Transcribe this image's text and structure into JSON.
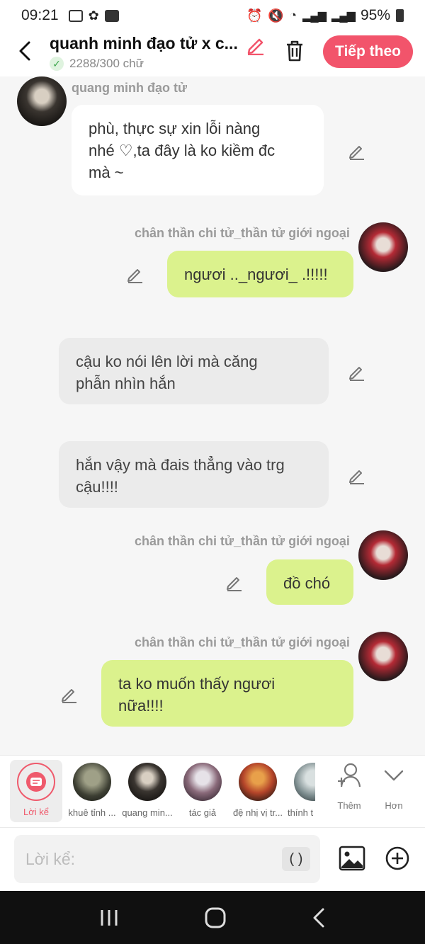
{
  "status_bar": {
    "time": "09:21",
    "battery": "95%"
  },
  "header": {
    "title": "quanh minh đạo tử x c...",
    "word_count": "2288/300 chữ",
    "next_label": "Tiếp theo"
  },
  "messages": [
    {
      "sender": "quang minh đạo tử",
      "text_lines": [
        "phù, thực sự xin lỗi nàng",
        "nhé ♡,ta đây  là ko kiềm đc",
        "mà ~"
      ]
    },
    {
      "sender": "chân thần chi tử_thần tử giới ngoại",
      "text_lines": [
        "ngươi .._ngươi_ .!!!!!"
      ]
    },
    {
      "text_lines": [
        "cậu ko nói lên lời mà căng",
        "phẫn nhìn hắn"
      ]
    },
    {
      "text_lines": [
        "hắn vậy mà đais thẳng vào trg",
        "cậu!!!!"
      ]
    },
    {
      "sender": "chân thần chi tử_thần tử giới ngoại",
      "text_lines": [
        "đồ chó"
      ]
    },
    {
      "sender": "chân thần chi tử_thần tử giới ngoại",
      "text_lines": [
        "ta ko muốn thấy ngươi",
        "nữa!!!!"
      ]
    }
  ],
  "characters": [
    {
      "name": "Lời kể"
    },
    {
      "name": "khuê tỉnh ..."
    },
    {
      "name": "quang min..."
    },
    {
      "name": "tác giả"
    },
    {
      "name": "đệ nhị vị tr..."
    },
    {
      "name": "thính t"
    }
  ],
  "more_label": "Thêm",
  "less_label": "Hơn",
  "input": {
    "placeholder": "Lời kể:",
    "paren_label": "( )"
  }
}
